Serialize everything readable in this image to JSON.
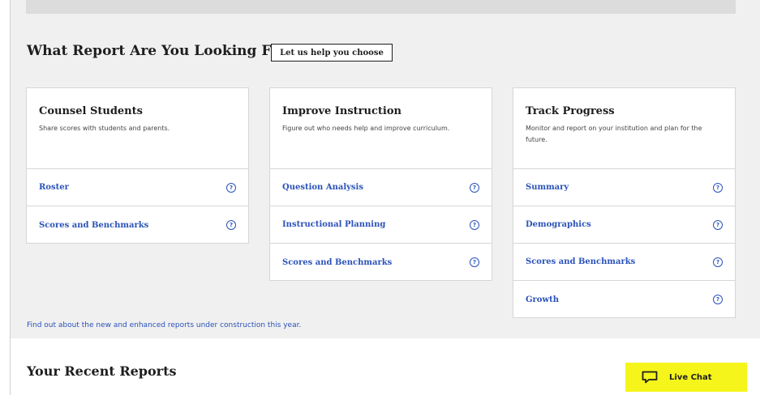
{
  "report_finder": {
    "heading": "What Report Are You Looking For?",
    "help_button": "Let us help you choose"
  },
  "cards": [
    {
      "title": "Counsel Students",
      "description": "Share scores with students and parents.",
      "links": [
        {
          "label": "Roster",
          "icon": "help-icon"
        },
        {
          "label": "Scores and Benchmarks",
          "icon": "help-icon"
        }
      ]
    },
    {
      "title": "Improve Instruction",
      "description": "Figure out who needs help and improve curriculum.",
      "links": [
        {
          "label": "Question Analysis",
          "icon": "help-icon"
        },
        {
          "label": "Instructional Planning",
          "icon": "help-icon"
        },
        {
          "label": "Scores and Benchmarks",
          "icon": "help-icon"
        }
      ]
    },
    {
      "title": "Track Progress",
      "description": "Monitor and report on your institution and plan for the future.",
      "links": [
        {
          "label": "Summary",
          "icon": "help-icon"
        },
        {
          "label": "Demographics",
          "icon": "help-icon"
        },
        {
          "label": "Scores and Benchmarks",
          "icon": "help-icon"
        },
        {
          "label": "Growth",
          "icon": "help-icon"
        }
      ]
    }
  ],
  "construction_link": "Find out about the new and enhanced reports under construction this year.",
  "recent_reports": {
    "heading": "Your Recent Reports"
  },
  "live_chat": {
    "label": "Live Chat",
    "icon": "chat-bubble-icon"
  },
  "colors": {
    "link": "#2a52b8",
    "background": "#f0f0f0",
    "live_chat_bg": "#f5f51c"
  }
}
